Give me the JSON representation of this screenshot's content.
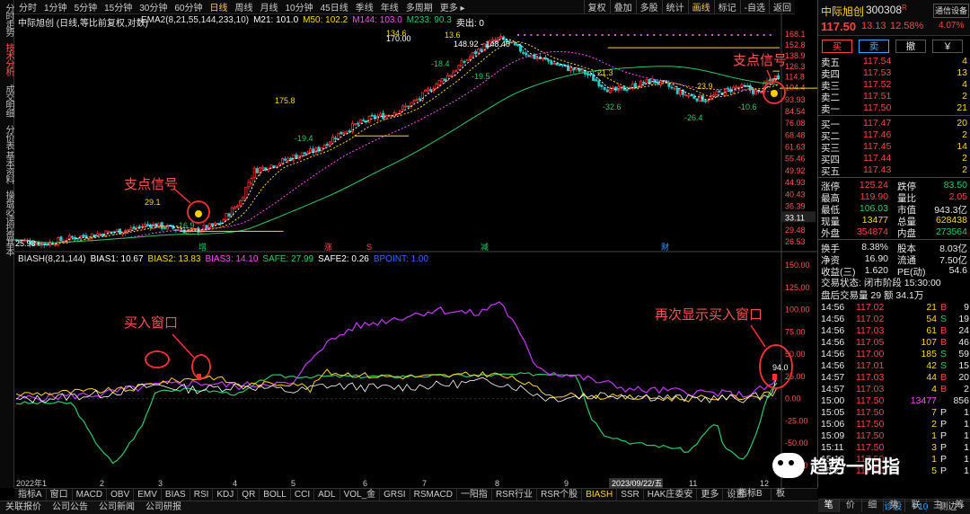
{
  "left_tabs": [
    "分时走势",
    "技术分析",
    "成交明细",
    "分价表",
    "基本资料",
    "操盘必读",
    "控盘基本"
  ],
  "periods": [
    "分时",
    "1分钟",
    "5分钟",
    "15分钟",
    "30分钟",
    "60分钟",
    "日线",
    "周线",
    "月线",
    "10分钟",
    "45日线",
    "季线",
    "年线",
    "多周期",
    "更多 ▸"
  ],
  "period_selected": "日线",
  "top_right_menu": [
    "复权",
    "叠加",
    "多股",
    "统计",
    "画线",
    "标记",
    "-自选",
    "返回"
  ],
  "stock_title": "中际旭创 (日线,等比前复权,对数)",
  "ema_legend": {
    "name": "EMA2(8,21,55,144,233,10)",
    "items": [
      {
        "label": "M21: 101.0",
        "color": "#ffffff"
      },
      {
        "label": "M50: 102.2",
        "color": "#ffd800"
      },
      {
        "label": "M144: 103.0",
        "color": "#ff44ff"
      },
      {
        "label": "M233: 90.3",
        "color": "#22cc66"
      },
      {
        "label": "卖出: 0",
        "color": "#ffffff"
      }
    ]
  },
  "bias_legend": {
    "name": "BIASH(8,21,144)",
    "items": [
      {
        "label": "BIAS1: 10.67",
        "color": "#ffffff"
      },
      {
        "label": "BIAS2: 13.83",
        "color": "#ffd800"
      },
      {
        "label": "BIAS3: 14.10",
        "color": "#ff44ff"
      },
      {
        "label": "SAFE: 27.99",
        "color": "#22cc66"
      },
      {
        "label": "SAFE2: 0.26",
        "color": "#ffffff"
      },
      {
        "label": "BPOINT: 1.00",
        "color": "#3366ff"
      }
    ]
  },
  "price_axis": [
    "168.1",
    "152.8",
    "138.9",
    "126.3",
    "114.8",
    "104.4",
    "93.93",
    "84.54",
    "76.08",
    "68.48",
    "61.63",
    "55.46",
    "49.92",
    "44.93",
    "40.43",
    "36.39",
    "32.75",
    "29.48",
    "26.53"
  ],
  "price_tag": "33.11",
  "bias_axis": [
    "150.00",
    "125.00",
    "100.00",
    "75.00",
    "50.00",
    "25.00",
    "0.00",
    "-25.00",
    "-50.00",
    "-75.00"
  ],
  "x_axis": [
    "2022年1",
    "2",
    "3",
    "4",
    "5",
    "6",
    "7",
    "8",
    "9",
    "10",
    "11",
    "12"
  ],
  "crosshair_date": "2023/09/22/五",
  "price_annotations": [
    "170.00",
    "134.6",
    "148.92 - 148.40",
    "13.6",
    "-18.4",
    "-19.5",
    "21.3",
    "23.9",
    "-32.6",
    "-26.4",
    "-10.6",
    "175.8",
    "-19.4",
    "29.1",
    "-16.9",
    "25.98"
  ],
  "chart_annotations": {
    "support1": "支点信号",
    "support2": "支点信号",
    "buy_window": "买入窗口",
    "buy_again": "再次显示买入窗口",
    "bias_value": "94.0"
  },
  "event_marks": [
    "增",
    "涨",
    "S",
    "减",
    "财"
  ],
  "bottom_tabs": [
    "指标A",
    "窗口",
    "MACD",
    "OBV",
    "EMV",
    "BIAS",
    "RSI",
    "KDJ",
    "QR",
    "BOLL",
    "CCI",
    "ADL",
    "VOL_金",
    "GRSI",
    "RSMACD",
    "一阳指",
    "RSR行业",
    "RSR个股",
    "BIASH",
    "SSR",
    "HAK庄委安",
    "更多",
    "设置"
  ],
  "bottom_selected": "BIASH",
  "bottom_right": [
    "指标B",
    "板"
  ],
  "status_items": [
    "关联报价",
    "公司公告",
    "公司新闻",
    "公司研报"
  ],
  "status_right": [
    "诊股",
    "F10",
    "侧边 +"
  ],
  "watermark": "趋势一阳指",
  "quote": {
    "name": "中际旭创",
    "code": "300308",
    "badge": "R",
    "tag": "通信设备",
    "price": "117.50",
    "change": "13.13",
    "pct": "12.58%",
    "pct2": "4.07%",
    "buttons": [
      "买",
      "卖",
      "撤",
      "￥"
    ],
    "sell": [
      {
        "l": "卖五",
        "p": "117.54",
        "v": "4"
      },
      {
        "l": "卖四",
        "p": "117.53",
        "v": "13"
      },
      {
        "l": "卖三",
        "p": "117.52",
        "v": "4"
      },
      {
        "l": "卖二",
        "p": "117.51",
        "v": "2"
      },
      {
        "l": "卖一",
        "p": "117.50",
        "v": "21"
      }
    ],
    "buy": [
      {
        "l": "买一",
        "p": "117.47",
        "v": "20"
      },
      {
        "l": "买二",
        "p": "117.46",
        "v": "2"
      },
      {
        "l": "买三",
        "p": "117.45",
        "v": "14"
      },
      {
        "l": "买四",
        "p": "117.44",
        "v": "2"
      },
      {
        "l": "买五",
        "p": "117.43",
        "v": "2"
      }
    ],
    "stats": [
      {
        "a": "涨停",
        "av": "125.24",
        "b": "跌停",
        "bv": "83.50"
      },
      {
        "a": "最高",
        "av": "119.90",
        "b": "量比",
        "bv": "2.05"
      },
      {
        "a": "最低",
        "av": "106.03",
        "b": "市值",
        "bv": "943.3亿"
      },
      {
        "a": "现量",
        "av": "13477",
        "b": "总量",
        "bv": "628438"
      },
      {
        "a": "外盘",
        "av": "354874",
        "b": "内盘",
        "bv": "273564"
      }
    ],
    "stats2": [
      {
        "a": "换手",
        "av": "8.38%",
        "b": "股本",
        "bv": "8.03亿"
      },
      {
        "a": "净资",
        "av": "16.90",
        "b": "流通",
        "bv": "7.50亿"
      },
      {
        "a": "收益(三)",
        "av": "1.620",
        "b": "PE(动)",
        "bv": "54.6"
      }
    ],
    "trade_state": "交易状态: 闭市阶段 15:30:00",
    "after_hours": "盘后交易量 29 额 34.1万",
    "ticks": [
      {
        "t": "14:56",
        "p": "117.02",
        "v": "21",
        "d": "B",
        "n": "9"
      },
      {
        "t": "14:56",
        "p": "117.02",
        "v": "54",
        "d": "S",
        "n": "19"
      },
      {
        "t": "14:56",
        "p": "117.03",
        "v": "61",
        "d": "B",
        "n": "24"
      },
      {
        "t": "14:56",
        "p": "117.05",
        "v": "107",
        "d": "B",
        "n": "46"
      },
      {
        "t": "14:56",
        "p": "117.00",
        "v": "185",
        "d": "S",
        "n": "59"
      },
      {
        "t": "14:56",
        "p": "117.01",
        "v": "42",
        "d": "S",
        "n": "15"
      },
      {
        "t": "14:57",
        "p": "117.03",
        "v": "44",
        "d": "B",
        "n": "20"
      },
      {
        "t": "14:57",
        "p": "117.03",
        "v": "4",
        "d": "B",
        "n": "2"
      },
      {
        "t": "15:00",
        "p": "117.50",
        "v": "13477",
        "d": "",
        "n": "856"
      },
      {
        "t": "15:05",
        "p": "117.50",
        "v": "7",
        "d": "P",
        "n": "1"
      },
      {
        "t": "15:06",
        "p": "117.50",
        "v": "2",
        "d": "P",
        "n": "1"
      },
      {
        "t": "15:09",
        "p": "117.50",
        "v": "1",
        "d": "P",
        "n": "1"
      },
      {
        "t": "15:11",
        "p": "117.50",
        "v": "3",
        "d": "P",
        "n": "1"
      },
      {
        "t": "15:13",
        "p": "117.50",
        "v": "1",
        "d": "P",
        "n": "1"
      },
      {
        "t": "15:22",
        "p": "117.50",
        "v": "5",
        "d": "P",
        "n": "1"
      }
    ],
    "tabs": [
      "笔",
      "价",
      "细",
      "势",
      "联",
      "主",
      "筹"
    ]
  },
  "colors": {
    "up": "#ff4040",
    "down": "#22cc66",
    "accent": "#ffcc33",
    "annot": "#ff5555"
  }
}
